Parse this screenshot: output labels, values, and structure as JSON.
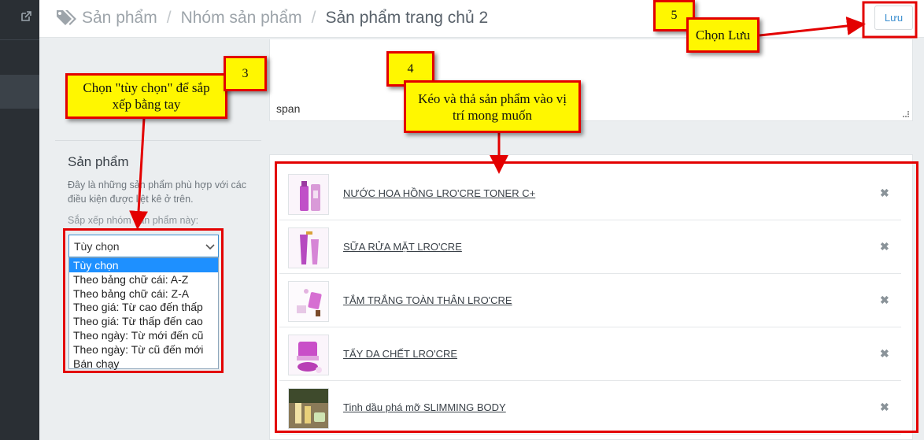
{
  "breadcrumb": {
    "items": [
      "Sản phẩm",
      "Nhóm sản phẩm",
      "Sản phẩm trang chủ 2"
    ],
    "separator": "/"
  },
  "toolbar": {
    "save_label": "Lưu"
  },
  "description_editor": {
    "value": "span"
  },
  "products_panel": {
    "title": "Sản phẩm",
    "description": "Đây là những sản phẩm phù hợp với các điều kiện được liệt kê ở trên.",
    "sort_label": "Sắp xếp nhóm sản phẩm này:"
  },
  "sort_select": {
    "selected": "Tùy chọn",
    "options": [
      "Tùy chọn",
      "Theo bảng chữ cái: A-Z",
      "Theo bảng chữ cái: Z-A",
      "Theo giá: Từ cao đến thấp",
      "Theo giá: Từ thấp đến cao",
      "Theo ngày: Từ mới đến cũ",
      "Theo ngày: Từ cũ đến mới",
      "Bán chạy"
    ]
  },
  "products": [
    {
      "name": "NƯỚC HOA HỒNG LRO'CRE TONER C+",
      "thumb_icon": "toner-bottle-image"
    },
    {
      "name": "SỮA RỬA MẶT LRO'CRE",
      "thumb_icon": "cleanser-tube-image"
    },
    {
      "name": "TẮM TRẮNG TOÀN THÂN LRO'CRE",
      "thumb_icon": "body-whitening-image"
    },
    {
      "name": "TẨY DA CHẾT LRO'CRE",
      "thumb_icon": "scrub-jar-image"
    },
    {
      "name": "Tinh dầu phá mỡ SLIMMING BODY",
      "thumb_icon": "slimming-oil-image"
    }
  ],
  "remove_glyph": "✖",
  "annotations": {
    "step3": {
      "number": "3",
      "text": "Chọn \"tùy chọn\" để sắp xếp bằng tay"
    },
    "step4": {
      "number": "4",
      "text": "Kéo và thả sản phẩm vào vị trí mong muốn"
    },
    "step5": {
      "number": "5",
      "text": "Chọn Lưu"
    }
  },
  "colors": {
    "accent": "#3b8fd0",
    "annotation_fill": "#fff700",
    "annotation_border": "#e30000",
    "selected_option": "#1e90ff",
    "sidebar": "#2a2f34"
  }
}
